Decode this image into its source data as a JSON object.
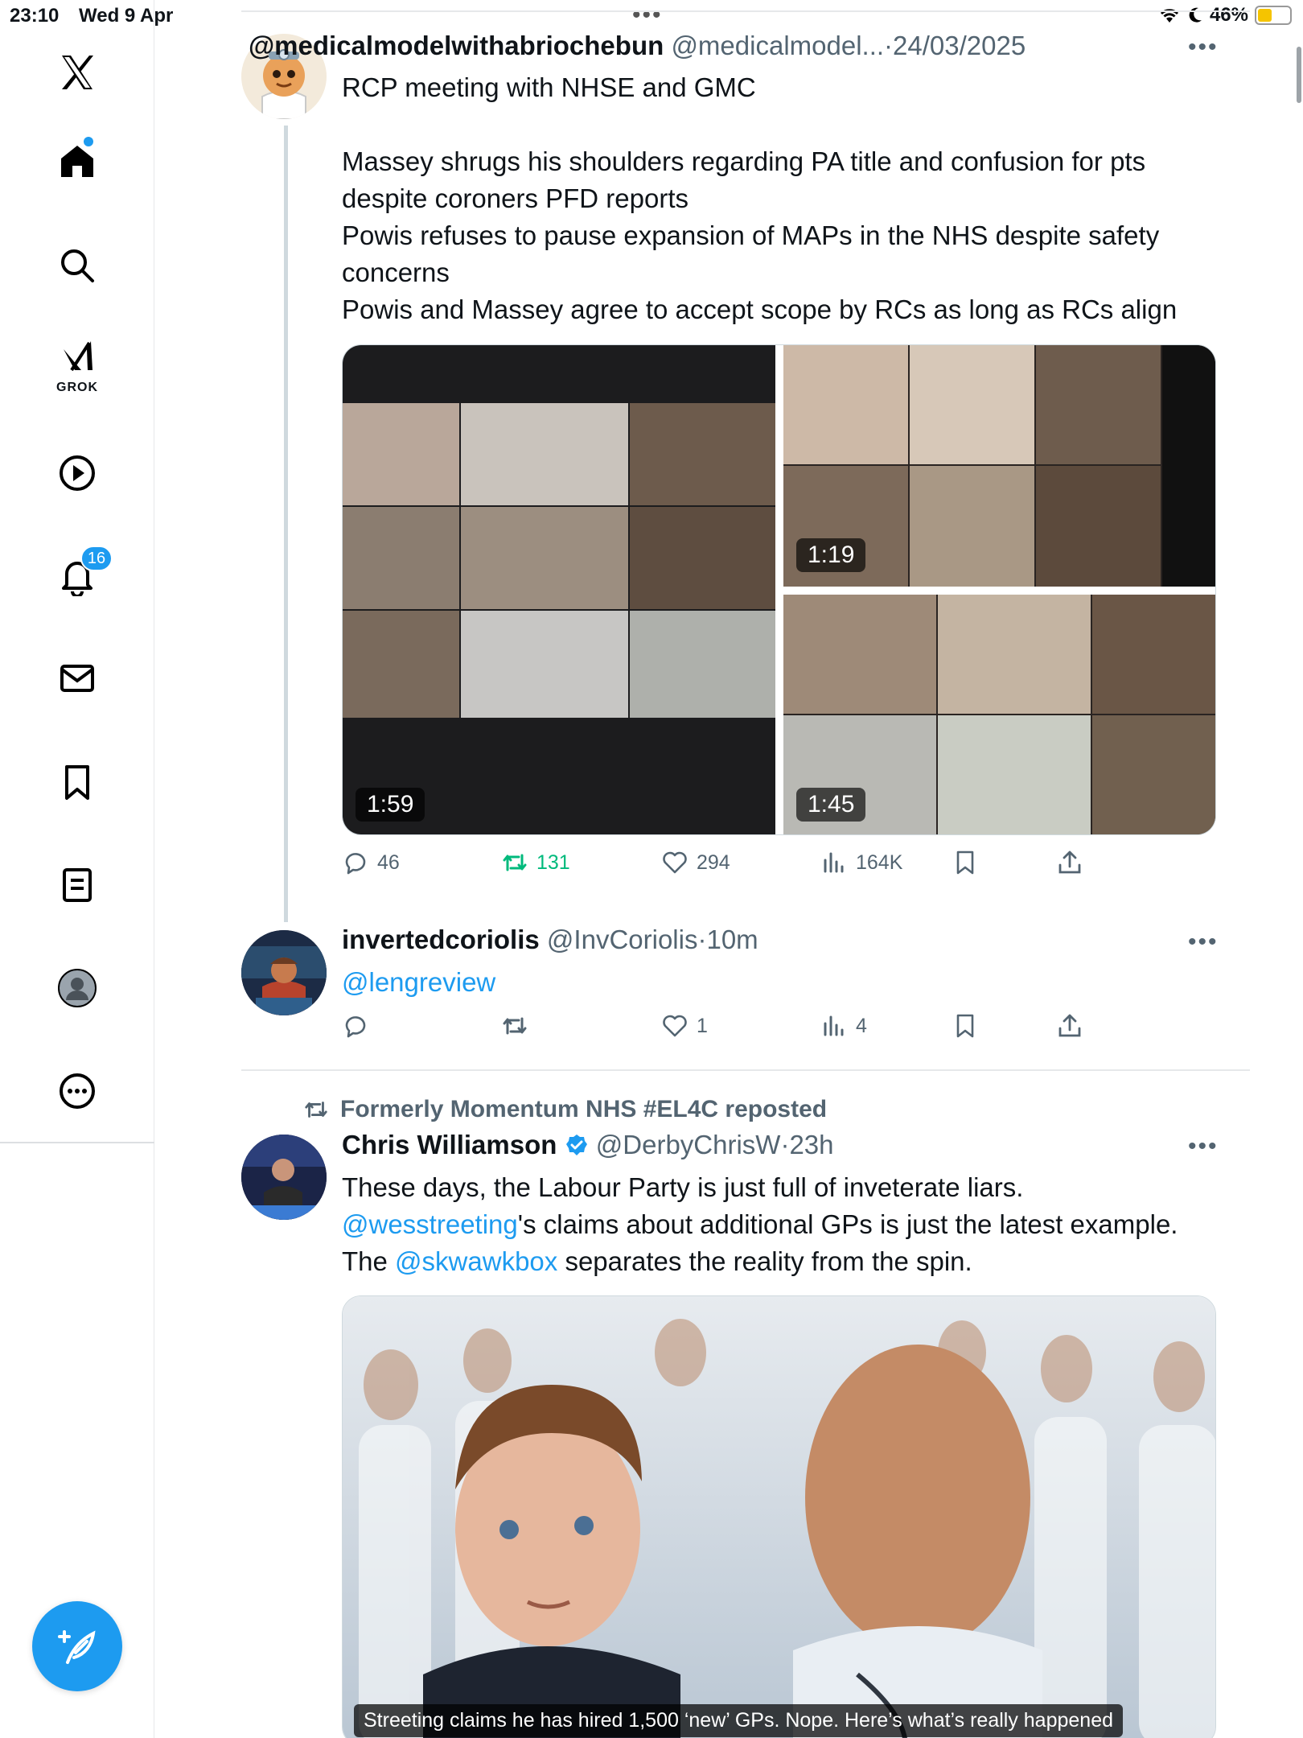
{
  "status_bar": {
    "time": "23:10",
    "date": "Wed 9 Apr",
    "battery": "46%",
    "battery_level": 0.46
  },
  "sidebar": {
    "grok_label": "GROK",
    "notifications_badge": "16"
  },
  "posts": [
    {
      "name": "@medicalmodelwithabriochebun",
      "handle": "@medicalmodel...",
      "separator": "·",
      "time": "24/03/2025",
      "lines": [
        "RCP meeting with NHSE and GMC",
        "Massey shrugs his shoulders regarding PA title and confusion for pts",
        "despite coroners PFD reports",
        "Powis refuses to pause expansion of MAPs in the NHS despite safety",
        "concerns",
        "Powis and Massey agree to accept scope by RCs as long as RCs align"
      ],
      "videos": [
        {
          "duration": "1:59"
        },
        {
          "duration": "1:19"
        },
        {
          "duration": "1:45"
        }
      ],
      "replies": "46",
      "reposts": "131",
      "likes": "294",
      "views": "164K"
    },
    {
      "name": "invertedcoriolis",
      "handle": "@InvCoriolis",
      "separator": "·",
      "time": "10m",
      "mention": "@lengreview",
      "replies": "",
      "reposts": "",
      "likes": "1",
      "views": "4"
    },
    {
      "repost_label": "Formerly Momentum NHS #EL4C reposted",
      "name": "Chris Williamson",
      "handle": "@DerbyChrisW",
      "separator": "·",
      "time": "23h",
      "line1": "These days, the Labour Party is just full of inveterate liars.",
      "line2_mention": "@wesstreeting",
      "line2_rest": "'s claims about additional GPs is just the latest example.",
      "line3_pre": "The ",
      "line3_mention": "@skwawkbox",
      "line3_rest": " separates the reality from the spin.",
      "image_caption": "Streeting claims he has hired 1,500 ‘new’ GPs. Nope. Here’s what’s really happened"
    }
  ],
  "colors": {
    "accent": "#1d9bf0",
    "muted": "#536471",
    "repost_green": "#00ba7c",
    "verified": "#1d9bf0"
  }
}
